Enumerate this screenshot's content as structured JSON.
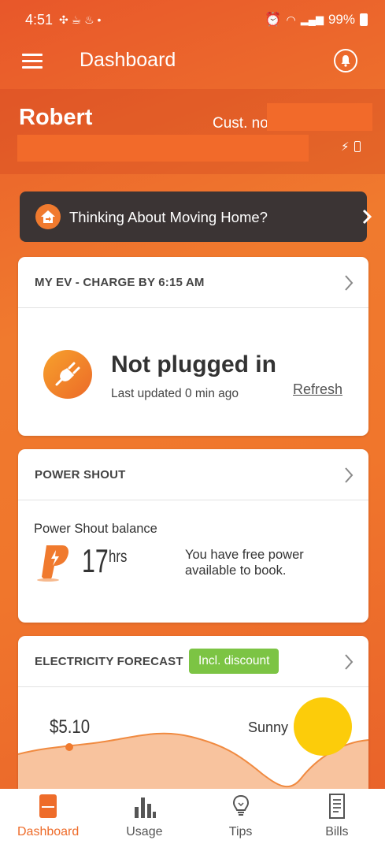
{
  "status_bar": {
    "time": "4:51",
    "battery": "99%"
  },
  "app_bar": {
    "title": "Dashboard"
  },
  "account": {
    "name": "Robert",
    "cust_no_label": "Cust. no"
  },
  "moving_banner": {
    "label": "Thinking About Moving Home?"
  },
  "ev_card": {
    "title": "MY EV - CHARGE BY 6:15 AM",
    "status": "Not plugged in",
    "updated": "Last updated 0 min ago",
    "refresh": "Refresh"
  },
  "power_shout": {
    "title": "POWER SHOUT",
    "balance_label": "Power Shout balance",
    "hours": "17",
    "unit": "hrs",
    "note": "You have free power available to book."
  },
  "forecast": {
    "title": "ELECTRICITY FORECAST",
    "badge": "Incl. discount",
    "price": "$5.10",
    "weather": "Sunny"
  },
  "bottom_nav": {
    "items": [
      {
        "label": "Dashboard",
        "icon": "dashboard-icon",
        "active": true
      },
      {
        "label": "Usage",
        "icon": "bar-chart-icon",
        "active": false
      },
      {
        "label": "Tips",
        "icon": "lightbulb-icon",
        "active": false
      },
      {
        "label": "Bills",
        "icon": "bill-icon",
        "active": false
      }
    ]
  },
  "colors": {
    "accent": "#EE6C2A",
    "banner": "#3B3434",
    "badge": "#7CC444",
    "sun": "#FCCC0A"
  }
}
